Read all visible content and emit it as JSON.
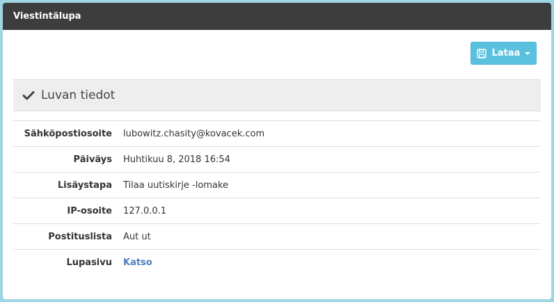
{
  "window": {
    "title": "Viestintälupa"
  },
  "toolbar": {
    "download_label": "Lataa",
    "download_icon": "floppy-disk-icon"
  },
  "panel": {
    "title": "Luvan tiedot",
    "icon": "checkmark-icon"
  },
  "details": {
    "rows": [
      {
        "label": "Sähköpostiosoite",
        "value": "lubowitz.chasity@kovacek.com"
      },
      {
        "label": "Päiväys",
        "value": "Huhtikuu 8, 2018 16:54"
      },
      {
        "label": "Lisäystapa",
        "value": "Tilaa uutiskirje -lomake"
      },
      {
        "label": "IP-osoite",
        "value": "127.0.0.1"
      },
      {
        "label": "Postituslista",
        "value": "Aut ut"
      },
      {
        "label": "Lupasivu",
        "value": "Katso"
      }
    ]
  },
  "colors": {
    "titlebar": "#3d3d3d",
    "button": "#5bc0de",
    "link": "#4b7fbf",
    "panel_head": "#eeeeee",
    "frame": "#9fd6e6"
  }
}
